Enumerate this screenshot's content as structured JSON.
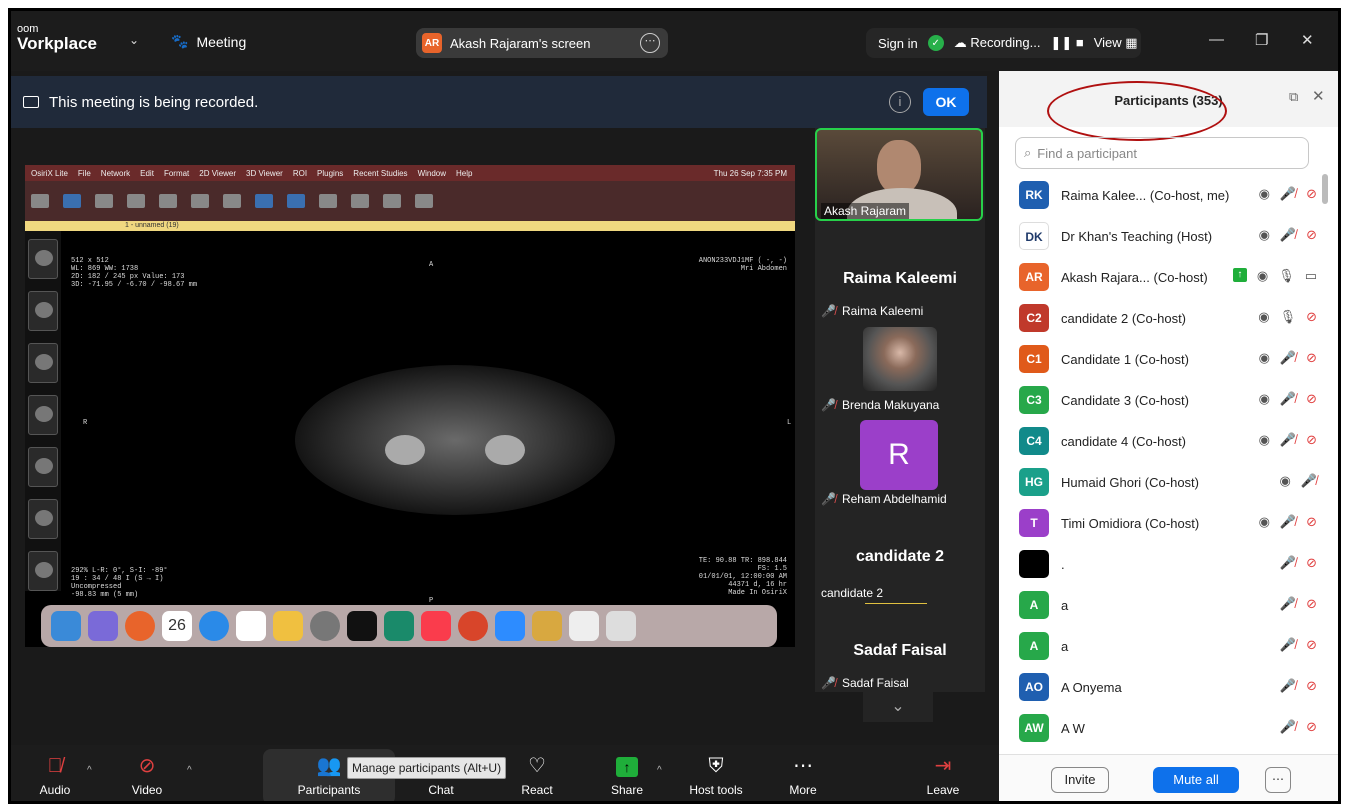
{
  "app": {
    "logo_line1": "oom",
    "logo_line2": "Vorkplace",
    "meeting_label": "Meeting",
    "screen_share_initials": "AR",
    "screen_share_label": "Akash Rajaram's screen",
    "sign_in": "Sign in",
    "recording_label": "Recording...",
    "view_label": "View"
  },
  "banner": {
    "text": "This meeting is being recorded.",
    "ok_label": "OK"
  },
  "shared_screen": {
    "menubar": [
      "OsiriX Lite",
      "File",
      "Network",
      "Edit",
      "Format",
      "2D Viewer",
      "3D Viewer",
      "ROI",
      "Plugins",
      "Recent Studies",
      "Window",
      "Help"
    ],
    "clock": "Thu 26 Sep 7:35 PM",
    "window_title": "1 - unnamed (19)",
    "info_top_left": [
      "512 x 512",
      "WL: 869 WW: 1738",
      "2D: 182 / 245 px Value: 173",
      "3D: -71.95 / -6.70 / -98.67 mm"
    ],
    "info_top_right": [
      "ANON233VDJ1MF ( -, -)",
      "Mri Abdomen"
    ],
    "info_bottom_left": [
      "292% L-R: 0°, S-I: -89°",
      "19 : 34 / 48 I (S → I)",
      "Uncompressed",
      "-98.83 mm (5 mm)"
    ],
    "info_bottom_right": [
      "TE: 90.88 TR: 898.844",
      "FS: 1.5",
      "01/01/01, 12:00:00 AM",
      "44371 d, 16 hr",
      "Made In OsiriX"
    ],
    "orient_top": "A",
    "orient_left": "R",
    "orient_right": "L",
    "orient_bottom": "P",
    "dock_date": "26"
  },
  "gallery": {
    "video_tile_name": "Akash Rajaram",
    "tiles": [
      {
        "big_name": "Raima Kaleemi",
        "label": "Raima Kaleemi"
      },
      {
        "label": "Brenda Makuyana"
      },
      {
        "avatar_letter": "R",
        "label": "Reham Abdelhamid"
      },
      {
        "big_name": "candidate 2",
        "label": "candidate 2"
      },
      {
        "big_name": "Sadaf Faisal",
        "label": "Sadaf Faisal"
      }
    ]
  },
  "participants": {
    "title": "Participants (353)",
    "search_placeholder": "Find a participant",
    "rows": [
      {
        "initials": "RK",
        "color": "#1f5fb0",
        "name": "Raima Kalee...  (Co-host, me)",
        "icons": "cohost-video-off"
      },
      {
        "initials": "DK",
        "color": "#ffffff",
        "name": "Dr Khan's Teaching (Host)",
        "icons": "cohost-video-off"
      },
      {
        "initials": "AR",
        "color": "#e8642b",
        "name": "Akash Rajara...  (Co-host)",
        "icons": "sharing-mic-on-video-on"
      },
      {
        "initials": "C2",
        "color": "#c0392b",
        "name": "candidate 2 (Co-host)",
        "icons": "mic-on-video-off"
      },
      {
        "initials": "C1",
        "color": "#e05a1a",
        "name": "Candidate 1 (Co-host)",
        "icons": "cohost-video-off"
      },
      {
        "initials": "C3",
        "color": "#27a84a",
        "name": "Candidate 3 (Co-host)",
        "icons": "cohost-video-off"
      },
      {
        "initials": "C4",
        "color": "#118a8a",
        "name": "candidate 4 (Co-host)",
        "icons": "cohost-video-off"
      },
      {
        "initials": "HG",
        "color": "#1aa08a",
        "name": "Humaid Ghori (Co-host)",
        "icons": "cohost-mic-off"
      },
      {
        "initials": "T",
        "color": "#9b3fc9",
        "name": "Timi Omidiora (Co-host)",
        "icons": "cohost-video-off"
      },
      {
        "initials": "",
        "color": "#000000",
        "name": ".",
        "icons": "video-off"
      },
      {
        "initials": "A",
        "color": "#27a84a",
        "name": "a",
        "icons": "video-off"
      },
      {
        "initials": "A",
        "color": "#27a84a",
        "name": "a",
        "icons": "video-off"
      },
      {
        "initials": "AO",
        "color": "#1f5fb0",
        "name": "A Onyema",
        "icons": "video-off"
      },
      {
        "initials": "AW",
        "color": "#27a84a",
        "name": "A W",
        "icons": "video-off"
      }
    ],
    "invite_label": "Invite",
    "mute_all_label": "Mute all"
  },
  "toolbar": {
    "audio": "Audio",
    "video": "Video",
    "participants": "Participants",
    "participants_tooltip": "Manage participants (Alt+U)",
    "chat": "Chat",
    "react": "React",
    "share": "Share",
    "host_tools": "Host tools",
    "more": "More",
    "leave": "Leave"
  }
}
